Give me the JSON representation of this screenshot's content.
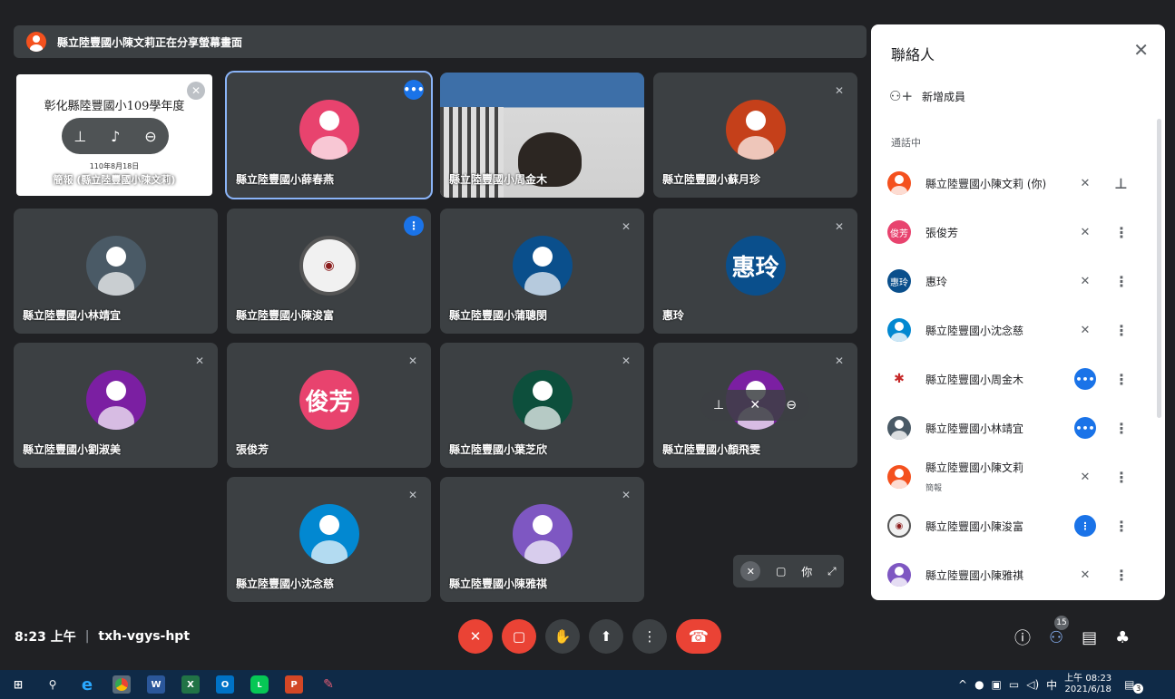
{
  "banner": {
    "text": "縣立陸豐國小陳文莉正在分享螢幕畫面"
  },
  "slide": {
    "line1": "彰化縣陸豐國小109學年度",
    "line2": "110年8月18日",
    "line3": "簡報 (縣立陸豐國小陳文莉)"
  },
  "tiles": {
    "xuechunyan": "縣立陸豐國小薛春燕",
    "zhoujinmu": "縣立陸豐國小周金木",
    "suyuezhen": "縣立陸豐國小蘇月珍",
    "linjingyi": "縣立陸豐國小林靖宜",
    "chenjunfu": "縣立陸豐國小陳浚富",
    "puconghui": "縣立陸豐國小蒲聰閔",
    "huiling": "惠玲",
    "huiling_avatar": "惠玲",
    "liushumei": "縣立陸豐國小劉淑美",
    "zhangjunfang": "張俊芳",
    "junfang_avatar": "俊芳",
    "yezhixin": "縣立陸豐國小葉芝欣",
    "yanfeiwen": "縣立陸豐國小顏飛雯",
    "shenniancin": "縣立陸豐國小沈念慈",
    "chenyaqi": "縣立陸豐國小陳雅祺"
  },
  "self_view": {
    "label": "你"
  },
  "panel": {
    "title": "聯絡人",
    "add_member": "新增成員",
    "in_call": "通話中",
    "people": [
      {
        "name": "縣立陸豐國小陳文莉 (你)",
        "avatar": ""
      },
      {
        "name": "張俊芳",
        "avatar": "俊芳"
      },
      {
        "name": "惠玲",
        "avatar": "惠玲"
      },
      {
        "name": "縣立陸豐國小沈念慈",
        "avatar": ""
      },
      {
        "name": "縣立陸豐國小周金木",
        "avatar": ""
      },
      {
        "name": "縣立陸豐國小林靖宜",
        "avatar": ""
      },
      {
        "name": "縣立陸豐國小陳文莉",
        "sub": "簡報",
        "avatar": ""
      },
      {
        "name": "縣立陸豐國小陳浚富",
        "avatar": ""
      },
      {
        "name": "縣立陸豐國小陳雅祺",
        "avatar": ""
      }
    ]
  },
  "bottom": {
    "time": "8:23 上午",
    "separator": "|",
    "meeting_code": "txh-vgys-hpt",
    "participant_count": "15"
  },
  "taskbar": {
    "ime": "中",
    "clock_time": "上午 08:23",
    "clock_date": "2021/6/18",
    "notification_count": "3"
  },
  "colors": {
    "accent": "#1a73e8",
    "danger": "#ea4335",
    "tile_bg": "#3c4043",
    "page_bg": "#202124"
  }
}
